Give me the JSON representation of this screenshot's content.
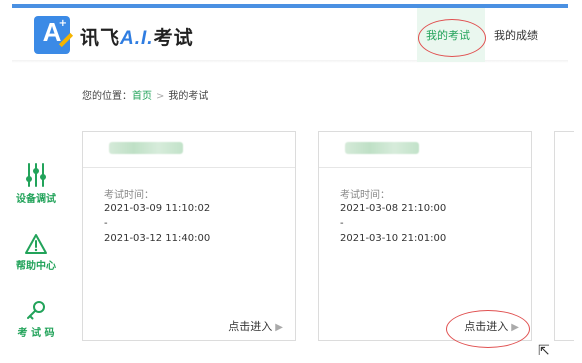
{
  "brand": {
    "logo_letter": "A",
    "logo_spark": "+",
    "name_prefix": "讯飞",
    "name_ai": "A.I.",
    "name_suffix": "考试",
    "accent_color": "#3b8ae6"
  },
  "nav": {
    "items": [
      {
        "label": "我的考试",
        "active": true
      },
      {
        "label": "我的成绩",
        "active": false
      }
    ],
    "active_color": "#22a35a"
  },
  "breadcrumb": {
    "prefix": "您的位置：",
    "home": "首页",
    "separator": ">",
    "current": "我的考试"
  },
  "sidebar": {
    "items": [
      {
        "label": "设备调试",
        "icon": "sliders-icon"
      },
      {
        "label": "帮助中心",
        "icon": "warning-icon"
      },
      {
        "label": "考 试 码",
        "icon": "key-icon"
      }
    ]
  },
  "exams": [
    {
      "time_label": "考试时间：",
      "start": "2021-03-09 11:10:02",
      "dash": "-",
      "end": "2021-03-12 11:40:00",
      "enter_label": "点击进入"
    },
    {
      "time_label": "考试时间：",
      "start": "2021-03-08 21:10:00",
      "dash": "-",
      "end": "2021-03-10 21:01:00",
      "enter_label": "点击进入"
    }
  ],
  "annotation_color": "#e05050"
}
